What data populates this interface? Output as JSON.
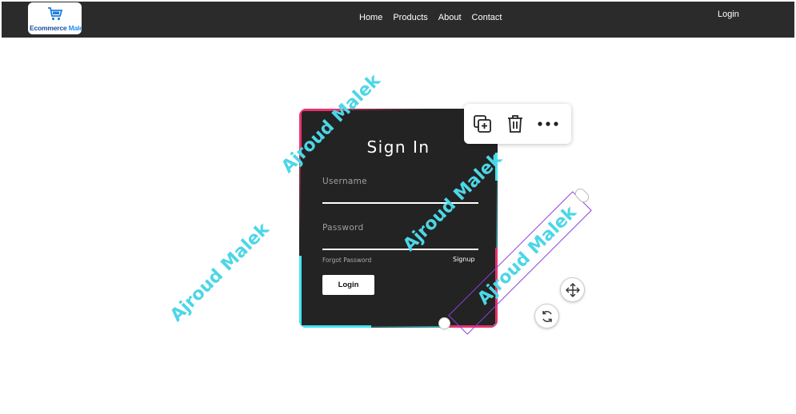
{
  "navbar": {
    "logo": {
      "text_part1": "Ecommerce",
      "text_part2": "Malek",
      "icon": "shopping-cart-icon"
    },
    "links": [
      {
        "label": "Home"
      },
      {
        "label": "Products"
      },
      {
        "label": "About"
      },
      {
        "label": "Contact"
      }
    ],
    "login_label": "Login"
  },
  "signin_card": {
    "title": "Sign In",
    "username_label": "Username",
    "username_value": "",
    "password_label": "Password",
    "password_value": "",
    "forgot_label": "Forgot Password",
    "signup_label": "Signup",
    "login_button_label": "Login"
  },
  "toolbar": {
    "icons": [
      "duplicate-icon",
      "trash-icon",
      "more-icon"
    ]
  },
  "watermarks": [
    {
      "text": "Ajroud Malek"
    },
    {
      "text": "Ajroud Malek"
    },
    {
      "text": "Ajroud Malek"
    },
    {
      "text": "Ajroud Malek"
    }
  ],
  "controls": {
    "move_icon": "move-arrows-icon",
    "rotate_icon": "rotate-icon"
  },
  "colors": {
    "navbar_bg": "#2b2b2b",
    "card_bg": "#232323",
    "accent_pink": "#e8336d",
    "accent_cyan": "#42e4f2",
    "watermark": "#4dd6e6",
    "selection": "#8b3fdc"
  }
}
